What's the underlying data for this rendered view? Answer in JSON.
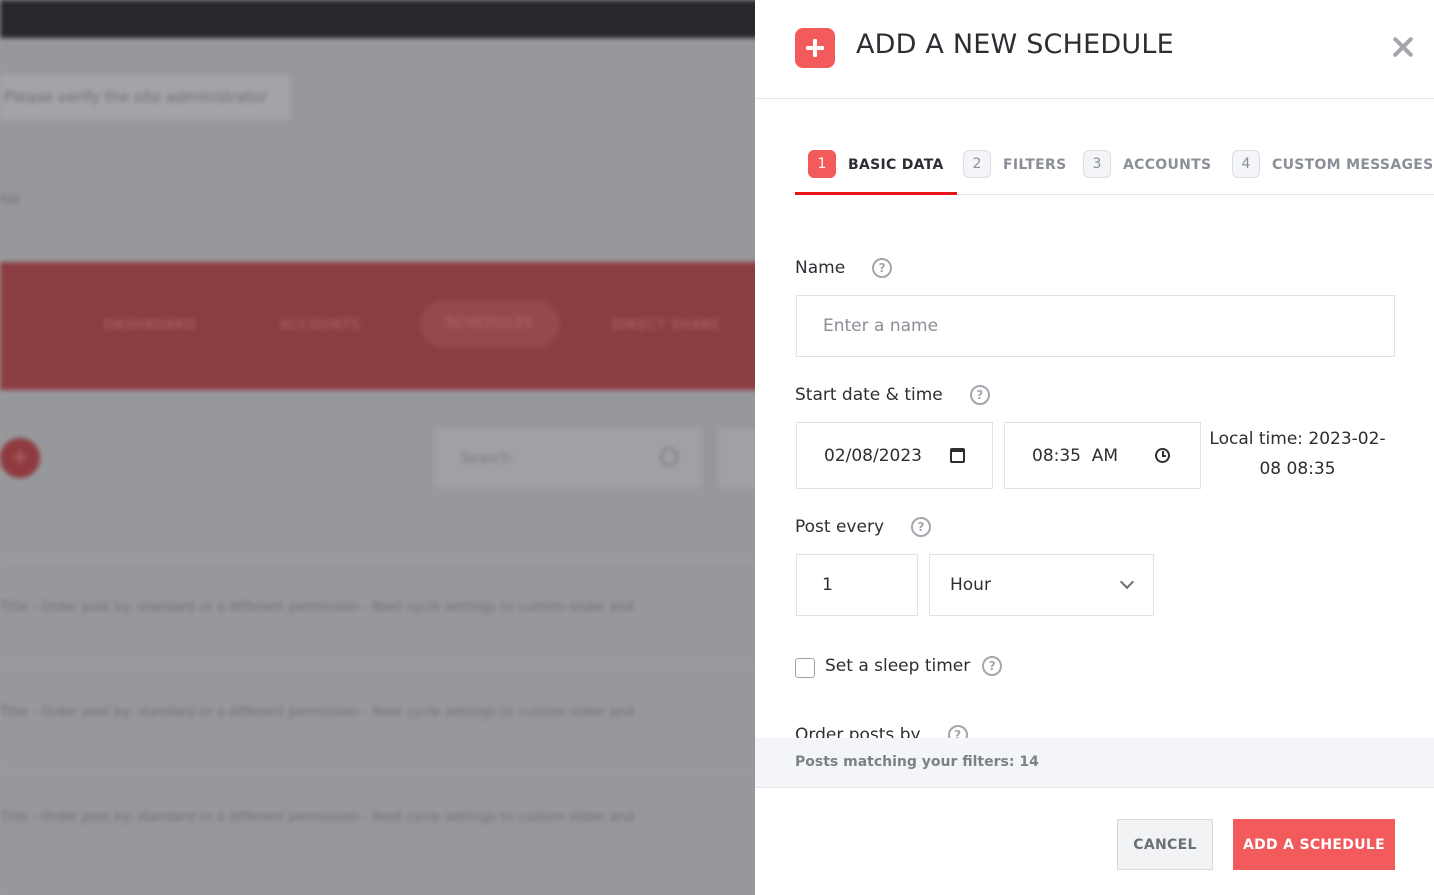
{
  "background": {
    "notice": "Please verify the site administrator",
    "crumb": "list",
    "nav": [
      "DASHBOARD",
      "ACCOUNTS",
      "SCHEDULES",
      "DIRECT SHARE"
    ],
    "plus": "+",
    "search_placeholder": "Search",
    "rows": [
      [
        "Title - Order post by: standard or a different permission - Next cycle settings to",
        "custom slider and"
      ],
      [
        "Title - Order post by: standard or a different permission - Next cycle settings to",
        "custom slider and"
      ],
      [
        "Title - Order post by: standard or a different permission - Next cycle settings to",
        "custom slider and"
      ]
    ]
  },
  "drawer": {
    "title": "ADD A NEW SCHEDULE",
    "tabs": [
      {
        "num": "1",
        "label": "BASIC DATA",
        "active": true
      },
      {
        "num": "2",
        "label": "FILTERS",
        "active": false
      },
      {
        "num": "3",
        "label": "ACCOUNTS",
        "active": false
      },
      {
        "num": "4",
        "label": "CUSTOM MESSAGES",
        "active": false
      }
    ],
    "help_glyph": "?",
    "name": {
      "label": "Name",
      "placeholder": "Enter a name",
      "value": ""
    },
    "start": {
      "label": "Start date & time",
      "date": "02/08/2023",
      "time": "08:35  AM",
      "local_time": "Local time: 2023-02-08 08:35"
    },
    "post_every": {
      "label": "Post every",
      "amount": "1",
      "unit": "Hour"
    },
    "sleep_timer": {
      "label": "Set a sleep timer",
      "checked": false
    },
    "order_posts": {
      "label": "Order posts by"
    },
    "matching": "Posts matching your filters: 14",
    "buttons": {
      "cancel": "CANCEL",
      "add": "ADD A SCHEDULE"
    }
  },
  "colors": {
    "accent": "#f25a5c",
    "tab_underline": "#e7141a",
    "text": "#2c2e33",
    "muted": "#8a8e96"
  }
}
